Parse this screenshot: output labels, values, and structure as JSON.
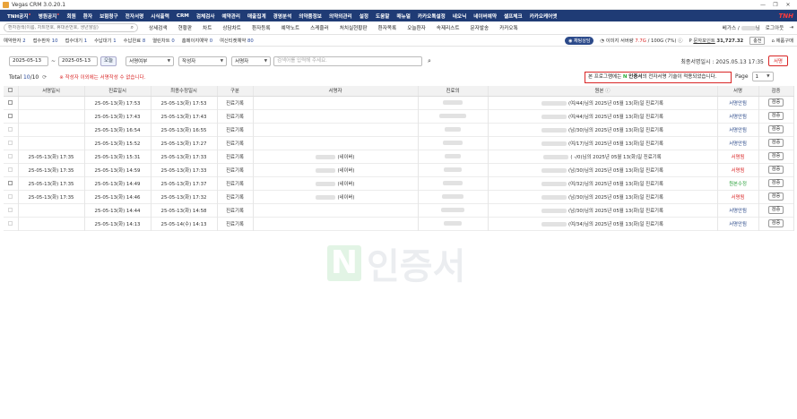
{
  "window": {
    "title": "Vegas CRM 3.0.20.1",
    "buttons": [
      "—",
      "❐",
      "✕"
    ]
  },
  "menu": {
    "items": [
      {
        "label": "TNH공지",
        "dot": true
      },
      {
        "label": "병원공지",
        "dot": true
      },
      {
        "label": "회원"
      },
      {
        "label": "환자"
      },
      {
        "label": "보험청구"
      },
      {
        "label": "전자서명"
      },
      {
        "label": "시식출력"
      },
      {
        "label": "CRM"
      },
      {
        "label": "검체검사"
      },
      {
        "label": "예약관리"
      },
      {
        "label": "매출집계"
      },
      {
        "label": "경영분석"
      },
      {
        "label": "의약품정보"
      },
      {
        "label": "의약외관리"
      },
      {
        "label": "설정"
      },
      {
        "label": "도움말"
      },
      {
        "label": "매뉴얼"
      },
      {
        "label": "카카오톡설정"
      },
      {
        "label": "네오닉"
      },
      {
        "label": "네이버예약"
      },
      {
        "label": "셀프체크"
      },
      {
        "label": "카카오케어앳"
      }
    ],
    "logo": "TNH"
  },
  "search": {
    "placeholder": "환자검색(이름, 차트번호, 휴대폰번호, 생년월일)",
    "sub_items": [
      "상세검색",
      "현황판",
      "차트",
      "상담차트",
      "환자등록",
      "예약노트",
      "스케줄러",
      "처치실현황판",
      "환자목록",
      "오늘환자",
      "속제리스트",
      "문자발송",
      "카카오톡"
    ],
    "user_suffix": "님",
    "user_prefix": "베가스 /",
    "logout": "로그아웃"
  },
  "status": {
    "items": [
      {
        "label": "예약환자",
        "value": "2"
      },
      {
        "label": "접수환자",
        "value": "10"
      },
      {
        "label": "접수대기",
        "value": "1"
      },
      {
        "label": "수납대기",
        "value": "1"
      },
      {
        "label": "수납완료",
        "value": "8"
      },
      {
        "label": "열린차트",
        "value": "0"
      },
      {
        "label": "홈페이지예약",
        "value": "0"
      },
      {
        "label": "여신티켓예약",
        "value": "80"
      }
    ],
    "chat": "채팅상담",
    "storage_prefix": "이미지 서버량",
    "storage_used": "7.7G",
    "storage_rest": "/ 100G (7%)",
    "points_label": "문자포인트",
    "points_value": "31,727.32",
    "charge": "충전",
    "purchase": "제품구매"
  },
  "filters": {
    "date_from": "2025-05-13",
    "date_to": "2025-05-13",
    "today": "오늘",
    "sign_status": "서명여부",
    "author": "작성자",
    "signer": "서명자",
    "keyword_placeholder": "검색어를 입력해 주세요.",
    "last_sign_label": "최종서명일시 : 2025.05.13 17:35",
    "sign_button": "서명"
  },
  "summary": {
    "total_label": "Total",
    "total_value": "10",
    "total_of": "/10",
    "warning": "※ 작성자 이외에는 서명작성 수 없습니다.",
    "notice_prefix": "본 프로그램에는",
    "notice_n": "N",
    "notice_brand": "인증서",
    "notice_suffix": "의 전자서명 기술이 적용되었습니다.",
    "page_label": "Page",
    "page_value": "1"
  },
  "table": {
    "headers": [
      "",
      "서명일시",
      "진료일시",
      "최종수정일시",
      "구분",
      "서명자",
      "진료의",
      "원본",
      "서명",
      "검증"
    ],
    "rows": [
      {
        "signed": "",
        "visit": "25-05-13(화) 17:53",
        "modified": "25-05-13(화) 17:53",
        "type": "진료기록",
        "signer": "",
        "original": "(여/44)님의 2025년 05월 13(화)일 진료기록",
        "status": "서명안됨",
        "status_class": "st-ok",
        "checked": true
      },
      {
        "signed": "",
        "visit": "25-05-13(화) 17:43",
        "modified": "25-05-13(화) 17:43",
        "type": "진료기록",
        "signer": "",
        "original": "(여/44)님의 2025년 05월 13(화)일 진료기록",
        "status": "서명안됨",
        "status_class": "st-ok",
        "checked": true
      },
      {
        "signed": "",
        "visit": "25-05-13(화) 16:54",
        "modified": "25-05-13(화) 16:55",
        "type": "진료기록",
        "signer": "",
        "original": "(남/30)님의 2025년 05월 13(화)일 진료기록",
        "status": "서명안됨",
        "status_class": "st-ok",
        "checked": false
      },
      {
        "signed": "",
        "visit": "25-05-13(화) 15:52",
        "modified": "25-05-13(화) 17:27",
        "type": "진료기록",
        "signer": "",
        "original": "(여/17)님의 2025년 05월 13(화)일 진료기록",
        "status": "서명안됨",
        "status_class": "st-ok",
        "checked": false
      },
      {
        "signed": "25-05-13(화) 17:35",
        "visit": "25-05-13(화) 15:31",
        "modified": "25-05-13(화) 17:33",
        "type": "진료기록",
        "signer": "(네이버)",
        "original": "( -/0)님의 2025년 05월 13(화)일 진료기록",
        "status": "서명됨",
        "status_class": "st-wait",
        "checked": false
      },
      {
        "signed": "25-05-13(화) 17:35",
        "visit": "25-05-13(화) 14:59",
        "modified": "25-05-13(화) 17:33",
        "type": "진료기록",
        "signer": "(네이버)",
        "original": "(남/30)님의 2025년 05월 13(화)일 진료기록",
        "status": "서명됨",
        "status_class": "st-wait",
        "checked": false
      },
      {
        "signed": "25-05-13(화) 17:35",
        "visit": "25-05-13(화) 14:49",
        "modified": "25-05-13(화) 17:37",
        "type": "진료기록",
        "signer": "(네이버)",
        "original": "(여/32)님의 2025년 05월 13(화)일 진료기록",
        "status": "원본수정",
        "status_class": "st-done",
        "checked": true
      },
      {
        "signed": "25-05-13(화) 17:35",
        "visit": "25-05-13(화) 14:46",
        "modified": "25-05-13(화) 17:32",
        "type": "진료기록",
        "signer": "(네이버)",
        "original": "(남/30)님의 2025년 05월 13(화)일 진료기록",
        "status": "서명됨",
        "status_class": "st-wait",
        "checked": false
      },
      {
        "signed": "",
        "visit": "25-05-13(화) 14:44",
        "modified": "25-05-13(화) 14:58",
        "type": "진료기록",
        "signer": "",
        "original": "(남/30)님의 2025년 05월 13(화)일 진료기록",
        "status": "서명안됨",
        "status_class": "st-ok",
        "checked": false
      },
      {
        "signed": "",
        "visit": "25-05-13(화) 14:13",
        "modified": "25-05-14(수) 14:13",
        "type": "진료기록",
        "signer": "",
        "original": "(여/34)님의 2025년 05월 13(화)일 진료기록",
        "status": "서명안됨",
        "status_class": "st-ok",
        "checked": false
      }
    ],
    "review_label": "검증"
  },
  "watermark": {
    "n": "N",
    "text": "인증서"
  }
}
